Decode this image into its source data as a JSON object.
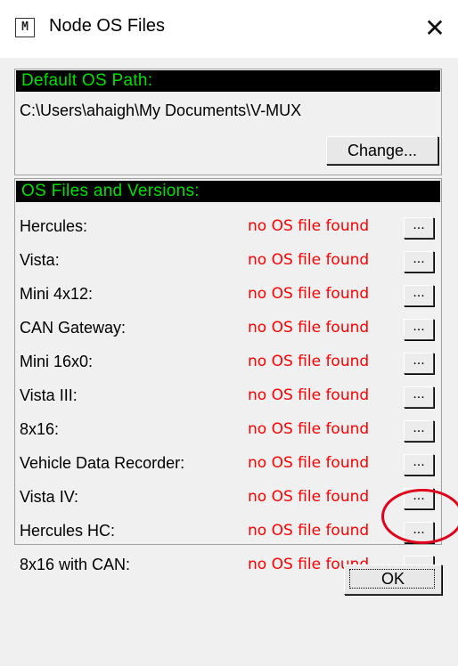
{
  "window": {
    "title": "Node OS Files",
    "icon": "app-icon",
    "close_glyph": "✕"
  },
  "default_path": {
    "header": "Default OS Path:",
    "path": "C:\\Users\\ahaigh\\My Documents\\V-MUX",
    "change_label": "Change..."
  },
  "os_files": {
    "header": "OS Files and Versions:",
    "browse_label": "...",
    "rows": [
      {
        "name": "Hercules:",
        "status": "no OS file found"
      },
      {
        "name": "Vista:",
        "status": "no OS file found"
      },
      {
        "name": "Mini 4x12:",
        "status": "no OS file found"
      },
      {
        "name": "CAN Gateway:",
        "status": "no OS file found"
      },
      {
        "name": "Mini 16x0:",
        "status": "no OS file found"
      },
      {
        "name": "Vista III:",
        "status": "no OS file found"
      },
      {
        "name": "8x16:",
        "status": "no OS file found"
      },
      {
        "name": "Vehicle Data Recorder:",
        "status": "no OS file found"
      },
      {
        "name": "Vista IV:",
        "status": "no OS file found"
      },
      {
        "name": "Hercules HC:",
        "status": "no OS file found"
      },
      {
        "name": "8x16 with CAN:",
        "status": "no OS file found"
      }
    ]
  },
  "ok_label": "OK",
  "colors": {
    "header_bg": "#000000",
    "header_text": "#00e000",
    "status_text": "#ff0000",
    "highlight": "#e0001a"
  }
}
